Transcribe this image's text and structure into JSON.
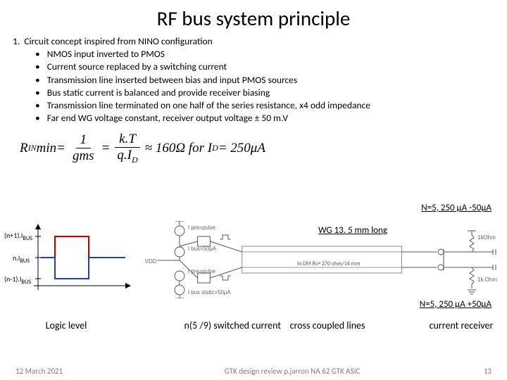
{
  "title": "RF bus system principle",
  "list": {
    "top": "Circuit concept inspired from NINO configuration",
    "items": [
      "NMOS input inverted to PMOS",
      "Current source replaced by a switching current",
      "Transmission line inserted  between  bias and  input PMOS sources",
      "Bus static current is balanced and provide receiver biasing",
      "Transmission line terminated on one half of the series resistance, x4 odd impedance",
      "Far end WG voltage constant, receiver output voltage ± 50 m.V"
    ]
  },
  "formula": {
    "lhs": "R",
    "lhs_sub": "IN",
    "min": " min",
    "eq1": " = ",
    "f1_num": "1",
    "f1_den": "gms",
    "eq2": " = ",
    "f2_num": "k.T",
    "f2_den": "q.I",
    "f2_den_sub": "D",
    "approx": " ≈ 160Ω   for I",
    "tail_sub": "D",
    "tail": " = 250μA"
  },
  "annot_top": "N=5, 250 µA -50µA",
  "annot_wg": "WG 13. 5 mm long",
  "annot_bot": "N=5, 250 µA +50µA",
  "logic_axes": {
    "y_top": "(n+1).I",
    "y_top_sub": "BUS",
    "y_mid": "n.I",
    "y_mid_sub": "BUS",
    "y_bot": "(n-1).I",
    "y_bot_sub": "BUS"
  },
  "mid_labels": {
    "pre_top": "I pre=pulse",
    "bus50": "I bus=50µA",
    "vdd": "VDD",
    "pre_bot": "I pre=pulse",
    "static": "I bus static=50µA",
    "dm": "In DM Rs= 270 ohm/14 mm"
  },
  "rx_labels": {
    "r1": "1kOhm",
    "r2": "1k.Ohm"
  },
  "bottom_labels": {
    "logic": "Logic level",
    "switched": "n(5 /9) switched current",
    "cc": "cross coupled lines",
    "rx": "current receiver"
  },
  "footer": {
    "date": "12 March 2021",
    "center": "GTK design review  p.jarron  NA 62 GTK ASIC",
    "page": "13"
  }
}
